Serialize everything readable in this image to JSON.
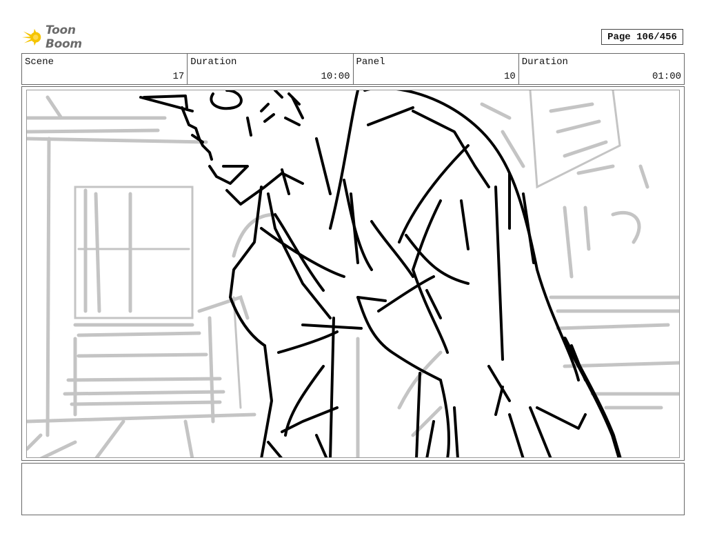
{
  "brand": {
    "name": "Toon Boom",
    "logo_icon": "sun-star-icon",
    "accent": "#f5c400"
  },
  "page": {
    "label": "Page 106/456"
  },
  "info": {
    "scene_label": "Scene",
    "scene_value": "17",
    "duration_label": "Duration",
    "duration_value": "10:00",
    "panel_label": "Panel",
    "panel_value": "10",
    "panel_duration_label": "Duration",
    "panel_duration_value": "01:00"
  },
  "artwork": {
    "description_icon": "storyboard-sketch",
    "line_color": "#000000",
    "background_line_color": "#c4c4c4"
  },
  "notes": {
    "text": ""
  }
}
